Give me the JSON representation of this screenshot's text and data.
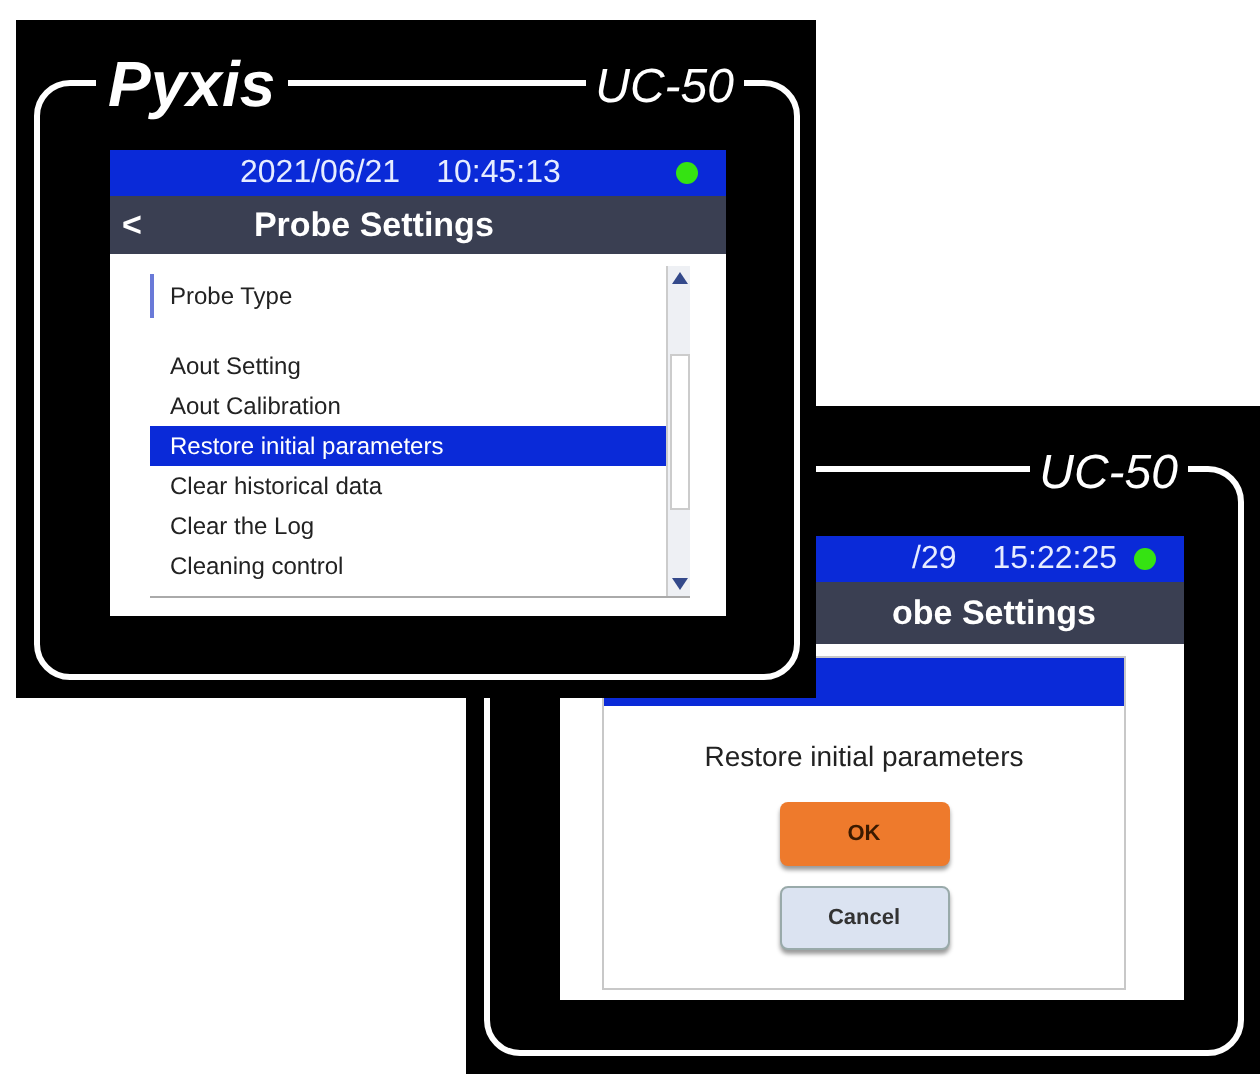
{
  "main_device": {
    "logo": "Pyxis",
    "model": "UC-50",
    "date": "2021/06/21",
    "time": "10:45:13",
    "back": "<",
    "title": "Probe Settings",
    "list": {
      "header": "Probe Type",
      "items": [
        {
          "label": "Aout Setting",
          "selected": false
        },
        {
          "label": "Aout Calibration",
          "selected": false
        },
        {
          "label": "Restore initial parameters",
          "selected": true
        },
        {
          "label": "Clear historical data",
          "selected": false
        },
        {
          "label": "Clear the Log",
          "selected": false
        },
        {
          "label": "Cleaning control",
          "selected": false
        }
      ]
    }
  },
  "dialog_device": {
    "model": "UC-50",
    "date": "/29",
    "time": "15:22:25",
    "title": "obe Settings",
    "dialog": {
      "message": "Restore initial parameters",
      "buttons": [
        {
          "label": "OK",
          "kind": "primary"
        },
        {
          "label": "Cancel",
          "kind": "secondary"
        }
      ]
    }
  }
}
